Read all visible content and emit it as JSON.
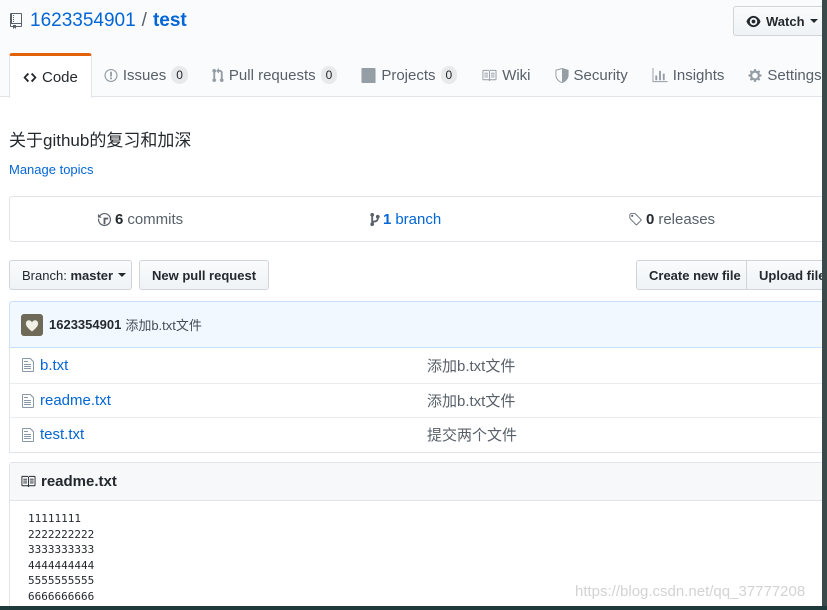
{
  "repo": {
    "owner": "1623354901",
    "separator": "/",
    "name": "test"
  },
  "watch_button": {
    "label": "Watch"
  },
  "tabs": [
    {
      "label": "Code",
      "icon": "code-icon"
    },
    {
      "label": "Issues",
      "icon": "issue-opened-icon",
      "count": "0"
    },
    {
      "label": "Pull requests",
      "icon": "git-pull-request-icon",
      "count": "0"
    },
    {
      "label": "Projects",
      "icon": "project-icon",
      "count": "0"
    },
    {
      "label": "Wiki",
      "icon": "book-icon"
    },
    {
      "label": "Security",
      "icon": "shield-icon"
    },
    {
      "label": "Insights",
      "icon": "graph-icon"
    },
    {
      "label": "Settings",
      "icon": "gear-icon"
    }
  ],
  "description": "关于github的复习和加深",
  "manage_topics": "Manage topics",
  "summary": {
    "commits": {
      "count": "6",
      "label": "commits"
    },
    "branches": {
      "count": "1",
      "label": "branch"
    },
    "releases": {
      "count": "0",
      "label": "releases"
    }
  },
  "toolbar": {
    "branch_prefix": "Branch:",
    "branch_name": "master",
    "new_pull_request": "New pull request",
    "create_new_file": "Create new file",
    "upload_files": "Upload files"
  },
  "latest_commit": {
    "author": "1623354901",
    "message": "添加b.txt文件"
  },
  "files": [
    {
      "name": "b.txt",
      "message": "添加b.txt文件"
    },
    {
      "name": "readme.txt",
      "message": "添加b.txt文件"
    },
    {
      "name": "test.txt",
      "message": "提交两个文件"
    }
  ],
  "readme": {
    "title": "readme.txt",
    "lines": [
      "11111111",
      "2222222222",
      "3333333333",
      "4444444444",
      "5555555555",
      "6666666666"
    ]
  },
  "watermark": "https://blog.csdn.net/qq_37777208",
  "colors": {
    "link": "#0366d6",
    "tab_accent": "#e36209",
    "commit_bg": "#f1f8ff"
  }
}
